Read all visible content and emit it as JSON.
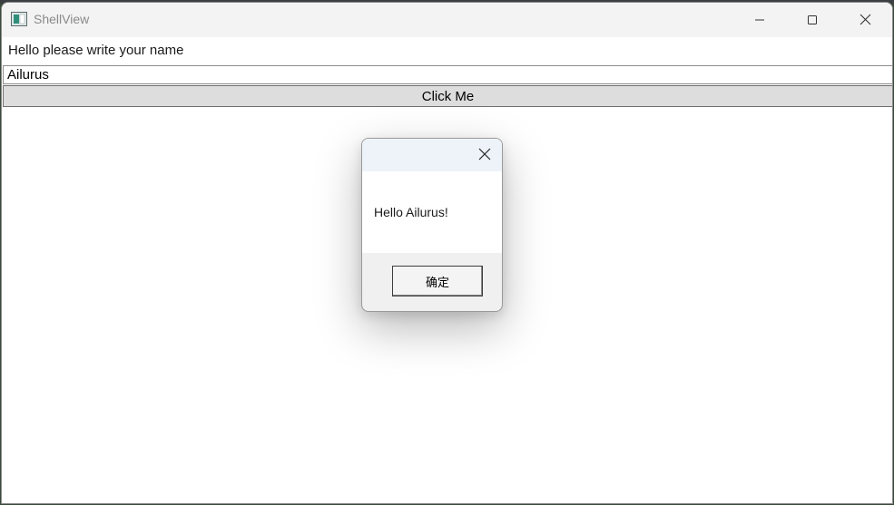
{
  "window": {
    "title": "ShellView",
    "icon": "app-window-icon",
    "caption_buttons": [
      "minimize-icon",
      "maximize-icon",
      "close-icon"
    ]
  },
  "main": {
    "prompt": "Hello please write your name",
    "name_value": "Ailurus",
    "button_label": "Click Me"
  },
  "dialog": {
    "message": "Hello Ailurus!",
    "ok_label": "确定",
    "close_icon": "close-icon"
  },
  "colors": {
    "titlebar": "#f3f3f3",
    "button_bg": "#dddddd",
    "dialog_bg": "#f0f0f0"
  }
}
